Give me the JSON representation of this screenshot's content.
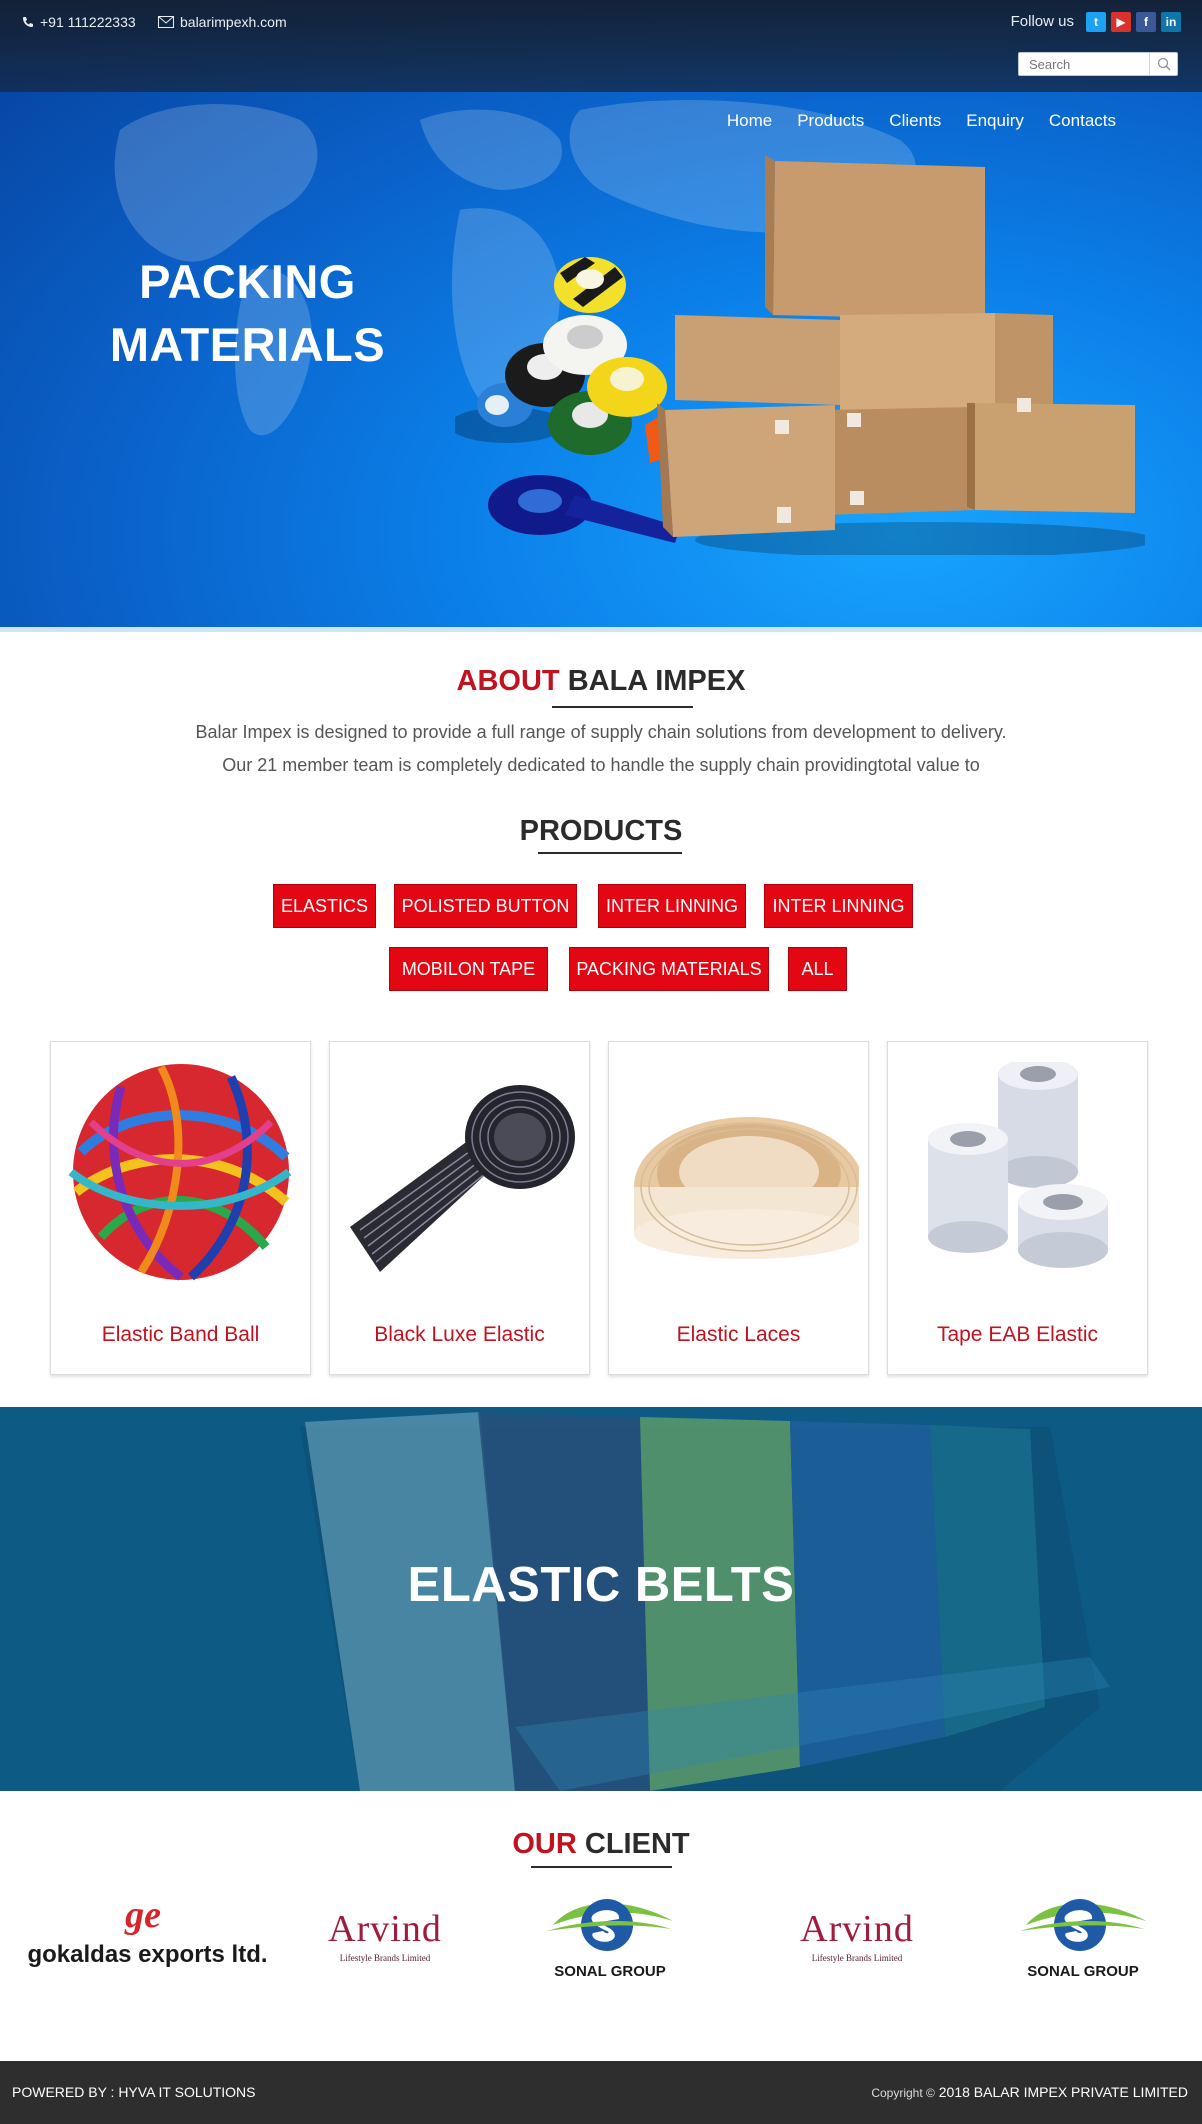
{
  "topbar": {
    "phone": "+91 111222333",
    "email": "balarimpexh.com",
    "follow_label": "Follow us",
    "social": [
      "twitter-icon",
      "youtube-icon",
      "facebook-icon",
      "linkedin-icon"
    ],
    "search_placeholder": "Search"
  },
  "nav": {
    "items": [
      "Home",
      "Products",
      "Clients",
      "Enquiry",
      "Contacts"
    ]
  },
  "hero": {
    "title_line1": "PACKING",
    "title_line2": "MATERIALS"
  },
  "about": {
    "title_highlight": "ABOUT",
    "title_rest": "BALA IMPEX",
    "line1": "Balar Impex is designed to provide a full range of supply chain solutions from development to delivery.",
    "line2": "Our 21 member team is completely dedicated to handle the supply chain providingtotal value to"
  },
  "products": {
    "title": "PRODUCTS",
    "filters": [
      "ELASTICS",
      "POLISTED BUTTON",
      "INTER LINNING",
      "INTER LINNING",
      "MOBILON TAPE",
      "PACKING MATERIALS",
      "ALL"
    ],
    "cards": [
      "Elastic Band Ball",
      "Black Luxe Elastic",
      "Elastic Laces",
      "Tape EAB Elastic"
    ]
  },
  "banner": {
    "title": "ELASTIC BELTS"
  },
  "clients": {
    "title_highlight": "OUR",
    "title_rest": "CLIENT",
    "logos": {
      "gokaldas_mark": "ge",
      "gokaldas_text": "gokaldas exports ltd.",
      "arvind_text": "Arvind",
      "arvind_sub": "Lifestyle Brands Limited",
      "sonal_text": "SONAL GROUP"
    }
  },
  "footer": {
    "powered": "POWERED BY : HYVA IT SOLUTIONS",
    "copyright_prefix": "Copyright ©",
    "copyright_rest": "2018 BALAR IMPEX PRIVATE LIMITED"
  },
  "colors": {
    "accent_red": "#c1121f",
    "button_red": "#e30613",
    "hero_blue": "#0b7fe8",
    "banner_blue": "#0d5a85",
    "footer_dark": "#2e2e2e"
  }
}
